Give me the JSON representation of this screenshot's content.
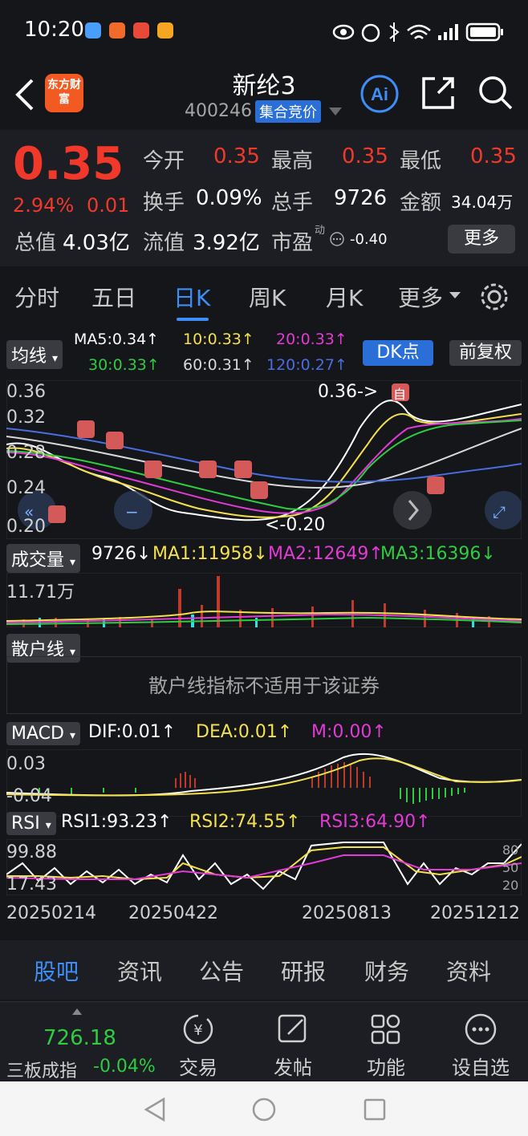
{
  "status_bar": {
    "time": "10:20"
  },
  "header": {
    "back_icon": "back-arrow-icon",
    "logo_text": "东方财富",
    "title": "新纶3",
    "code": "400246",
    "mode": "集合竞价"
  },
  "quote": {
    "price": "0.35",
    "change_pct": "2.94%",
    "change": "0.01",
    "open_label": "今开",
    "open": "0.35",
    "high_label": "最高",
    "high": "0.35",
    "low_label": "最低",
    "low": "0.35",
    "turnover_label": "换手",
    "turnover": "0.09%",
    "volume_label": "总手",
    "volume": "9726",
    "amount_label": "金额",
    "amount": "34.04万",
    "mktcap_label": "总值",
    "mktcap": "4.03亿",
    "float_label": "流值",
    "float": "3.92亿",
    "pe_label": "市盈",
    "pe_sup": "动",
    "pe": "-0.40",
    "more": "更多"
  },
  "periods": [
    "分时",
    "五日",
    "日K",
    "周K",
    "月K",
    "更多"
  ],
  "chart": {
    "ma_btn": "均线",
    "ma5": "MA5:0.34↑",
    "ma10": "10:0.33↑",
    "ma20": "20:0.33↑",
    "ma30": "30:0.33↑",
    "ma60": "60:0.31↑",
    "ma120": "120:0.27↑",
    "dk_btn": "DK点",
    "fq_btn": "前复权",
    "y_labels": [
      "0.36",
      "0.32",
      "0.28",
      "0.24",
      "0.20"
    ],
    "max_note": "0.36->",
    "min_note": "<-0.20",
    "self_tag": "自",
    "vol_btn": "成交量",
    "vol_val": "9726↓",
    "vol_ma1": "MA1:11958↓",
    "vol_ma2": "MA2:12649↑",
    "vol_ma3": "MA3:16396↓",
    "vol_max": "11.71万",
    "retail_btn": "散户线",
    "retail_notice": "散户线指标不适用于该证券",
    "macd_btn": "MACD",
    "dif": "DIF:0.01↑",
    "dea": "DEA:0.01↑",
    "m": "M:0.00↑",
    "macd_top": "0.03",
    "macd_bot": "-0.04",
    "rsi_btn": "RSI",
    "rsi1": "RSI1:93.23↑",
    "rsi2": "RSI2:74.55↑",
    "rsi3": "RSI3:64.90↑",
    "rsi_top": "99.88",
    "rsi_bot": "17.43",
    "rsi_r1": "80",
    "rsi_r2": "50",
    "rsi_r3": "20",
    "dates": [
      "20250214",
      "20250422",
      "20250813",
      "20251212"
    ]
  },
  "bottom_tabs": [
    "股吧",
    "资讯",
    "公告",
    "研报",
    "财务",
    "资料"
  ],
  "toolbar": {
    "index_value": "726.18",
    "index_name": "三板成指",
    "index_change": "-0.04%",
    "trade": "交易",
    "post": "发帖",
    "features": "功能",
    "watchlist": "设自选"
  }
}
